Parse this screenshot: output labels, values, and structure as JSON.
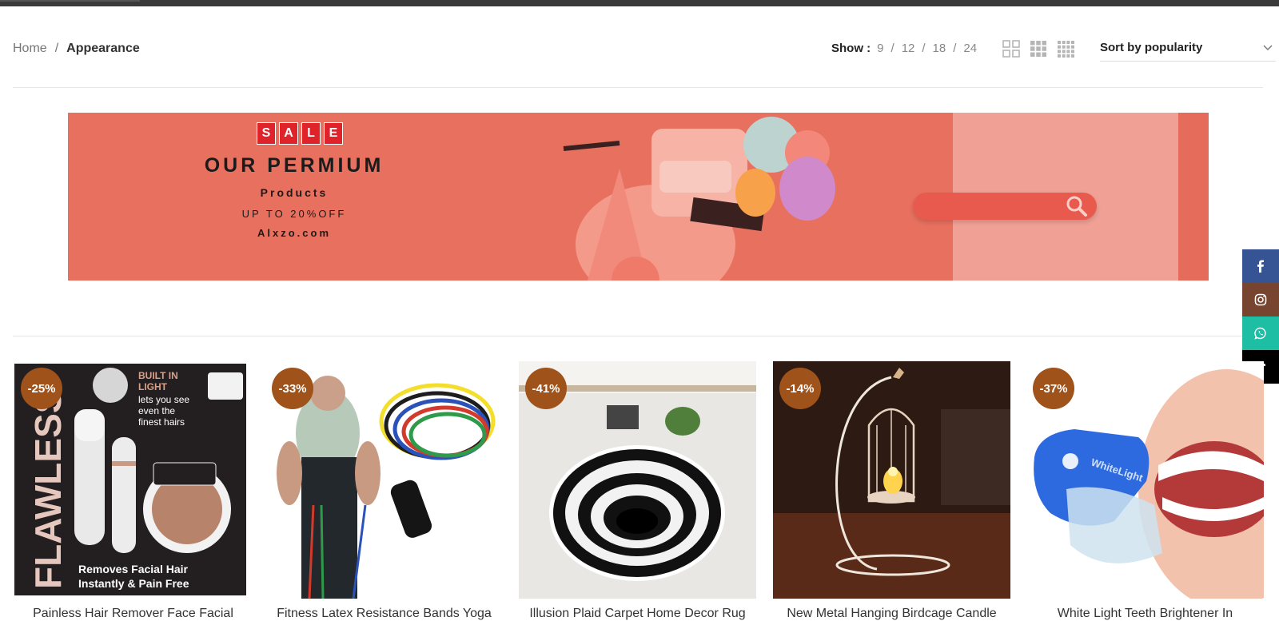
{
  "breadcrumb": {
    "home": "Home",
    "separator": "/",
    "current": "Appearance"
  },
  "toolbar": {
    "show_label": "Show :",
    "show_options": [
      "9",
      "12",
      "18",
      "24"
    ],
    "separator": "/",
    "grid_icons": [
      "grid-2-icon",
      "grid-3-icon",
      "grid-4-icon"
    ],
    "sort_selected": "Sort by popularity"
  },
  "banner": {
    "sale_letters": [
      "S",
      "A",
      "L",
      "E"
    ],
    "headline": "OUR PERMIUM",
    "subhead": "Products",
    "offer": "UP TO 20%OFF",
    "site": "Alxzo.com"
  },
  "social": [
    {
      "name": "facebook-icon",
      "color": "#365493",
      "glyph": "f"
    },
    {
      "name": "instagram-icon",
      "color": "#774430",
      "glyph": "◎"
    },
    {
      "name": "whatsapp-icon",
      "color": "#1ebea5",
      "glyph": "✆"
    },
    {
      "name": "tiktok-icon",
      "color": "#000000",
      "glyph": "♪"
    }
  ],
  "products": [
    {
      "discount": "-25%",
      "title": "Painless Hair Remover Face Facial",
      "image_label": "FLAWLESS",
      "image_sub": "Removes Facial Hair Instantly & Pain Free"
    },
    {
      "discount": "-33%",
      "title": "Fitness Latex Resistance Bands Yoga"
    },
    {
      "discount": "-41%",
      "title": "Illusion Plaid Carpet Home Decor Rug"
    },
    {
      "discount": "-14%",
      "title": "New Metal Hanging Birdcage Candle"
    },
    {
      "discount": "-37%",
      "title": "White Light Teeth Brightener In"
    }
  ],
  "colors": {
    "badge": "#a0521b",
    "banner_bg": "#e8705f",
    "accent_text": "#222222"
  }
}
